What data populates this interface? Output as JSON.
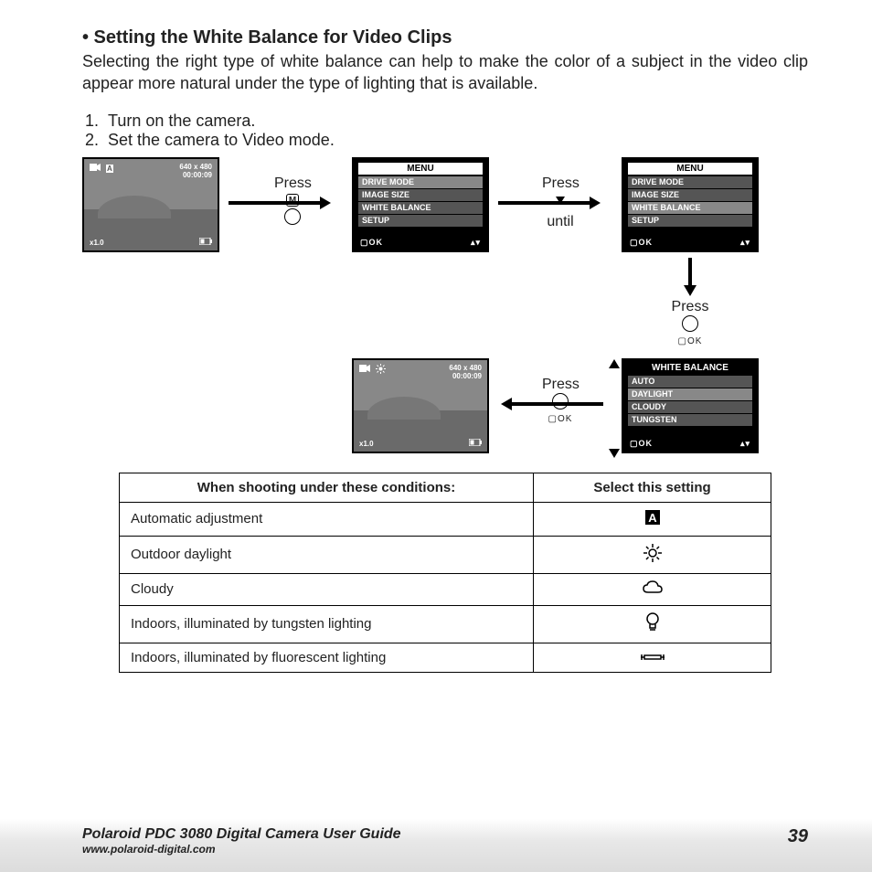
{
  "heading": "• Setting the White Balance for Video Clips",
  "intro": "Selecting the right type of white balance can help to make the color of a subject in the video clip appear more natural under the type of lighting that is available.",
  "steps": [
    {
      "num": "1.",
      "text": "Turn on the camera."
    },
    {
      "num": "2.",
      "text": "Set the camera to Video mode."
    }
  ],
  "lcd_photo": {
    "resolution": "640 x 480",
    "time": "00:00:09",
    "zoom": "x1.0"
  },
  "menu": {
    "title": "MENU",
    "items": [
      "DRIVE MODE",
      "IMAGE SIZE",
      "WHITE BALANCE",
      "SETUP"
    ],
    "ok": "OK"
  },
  "wb_menu": {
    "title": "WHITE BALANCE",
    "items": [
      "AUTO",
      "DAYLIGHT",
      "CLOUDY",
      "TUNGSTEN"
    ],
    "ok": "OK"
  },
  "labels": {
    "press": "Press",
    "until": "until",
    "ok": "OK",
    "m": "M"
  },
  "table": {
    "headers": [
      "When shooting under these conditions:",
      "Select this setting"
    ],
    "rows": [
      {
        "cond": "Automatic adjustment",
        "icon": "auto"
      },
      {
        "cond": "Outdoor daylight",
        "icon": "sun"
      },
      {
        "cond": "Cloudy",
        "icon": "cloud"
      },
      {
        "cond": "Indoors, illuminated by tungsten lighting",
        "icon": "bulb"
      },
      {
        "cond": "Indoors, illuminated by fluorescent lighting",
        "icon": "fluor"
      }
    ]
  },
  "footer": {
    "title": "Polaroid PDC 3080 Digital Camera User Guide",
    "url": "www.polaroid-digital.com",
    "page": "39"
  }
}
